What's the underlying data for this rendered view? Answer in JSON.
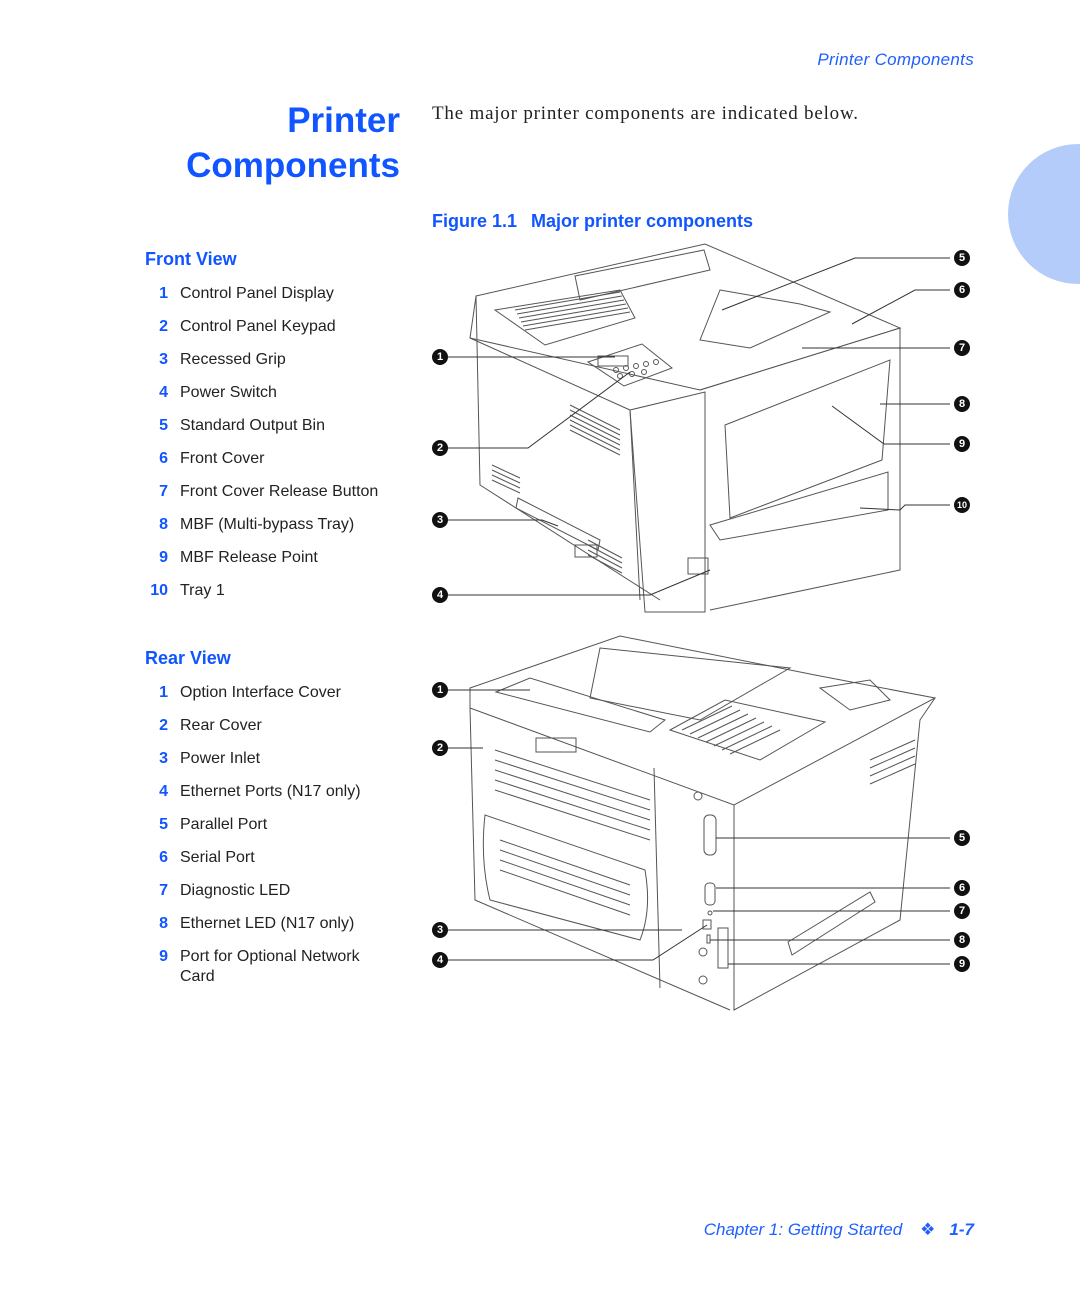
{
  "running_head": "Printer Components",
  "page_title": [
    "Printer",
    "Components"
  ],
  "intro_text": "The major printer components are indicated below.",
  "figure": {
    "number": "Figure 1.1",
    "title": "Major printer components"
  },
  "front_view": {
    "heading": "Front View",
    "items": [
      {
        "n": "1",
        "label": "Control Panel Display"
      },
      {
        "n": "2",
        "label": "Control Panel Keypad"
      },
      {
        "n": "3",
        "label": "Recessed Grip"
      },
      {
        "n": "4",
        "label": "Power Switch"
      },
      {
        "n": "5",
        "label": "Standard Output Bin"
      },
      {
        "n": "6",
        "label": "Front Cover"
      },
      {
        "n": "7",
        "label": "Front Cover Release Button"
      },
      {
        "n": "8",
        "label": "MBF (Multi-bypass Tray)"
      },
      {
        "n": "9",
        "label": "MBF Release Point"
      },
      {
        "n": "10",
        "label": "Tray 1"
      }
    ]
  },
  "rear_view": {
    "heading": "Rear View",
    "items": [
      {
        "n": "1",
        "label": "Option Interface Cover"
      },
      {
        "n": "2",
        "label": "Rear Cover"
      },
      {
        "n": "3",
        "label": "Power Inlet"
      },
      {
        "n": "4",
        "label": "Ethernet Ports (N17 only)"
      },
      {
        "n": "5",
        "label": "Parallel Port"
      },
      {
        "n": "6",
        "label": "Serial Port"
      },
      {
        "n": "7",
        "label": "Diagnostic LED"
      },
      {
        "n": "8",
        "label": "Ethernet LED (N17 only)"
      },
      {
        "n": "9",
        "label": "Port for Optional Network Card"
      }
    ]
  },
  "front_callouts": [
    "1",
    "2",
    "3",
    "4",
    "5",
    "6",
    "7",
    "8",
    "9",
    "10"
  ],
  "rear_callouts": [
    "1",
    "2",
    "3",
    "4",
    "5",
    "6",
    "7",
    "8",
    "9"
  ],
  "footer": {
    "chapter": "Chapter 1: Getting Started",
    "separator": "❖",
    "page": "1-7"
  },
  "colors": {
    "accent": "#1055ff",
    "tab": "#b3ccfa"
  }
}
